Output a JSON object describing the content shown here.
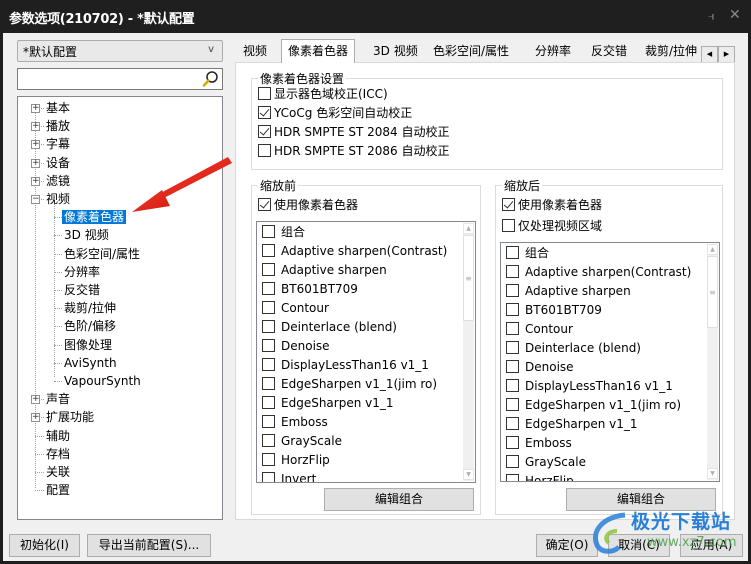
{
  "window": {
    "title": "参数选项(210702) - *默认配置",
    "pin_icon": "pin-icon",
    "close_icon": "close-icon"
  },
  "sidebar": {
    "profile_select": {
      "value": "*默认配置",
      "arrow": "v"
    },
    "search": {
      "value": "",
      "placeholder": "",
      "icon": "magnifier-icon"
    },
    "tree": [
      {
        "label": "基本",
        "level": 0,
        "expander": "+"
      },
      {
        "label": "播放",
        "level": 0,
        "expander": "+"
      },
      {
        "label": "字幕",
        "level": 0,
        "expander": "+"
      },
      {
        "label": "设备",
        "level": 0,
        "expander": "+"
      },
      {
        "label": "滤镜",
        "level": 0,
        "expander": "+"
      },
      {
        "label": "视频",
        "level": 0,
        "expander": "−"
      },
      {
        "label": "像素着色器",
        "level": 1,
        "selected": true
      },
      {
        "label": "3D 视频",
        "level": 1
      },
      {
        "label": "色彩空间/属性",
        "level": 1
      },
      {
        "label": "分辨率",
        "level": 1
      },
      {
        "label": "反交错",
        "level": 1
      },
      {
        "label": "裁剪/拉伸",
        "level": 1
      },
      {
        "label": "色阶/偏移",
        "level": 1
      },
      {
        "label": "图像处理",
        "level": 1
      },
      {
        "label": "AviSynth",
        "level": 1
      },
      {
        "label": "VapourSynth",
        "level": 1
      },
      {
        "label": "声音",
        "level": 0,
        "expander": "+"
      },
      {
        "label": "扩展功能",
        "level": 0,
        "expander": "+"
      },
      {
        "label": "辅助",
        "level": 0
      },
      {
        "label": "存档",
        "level": 0
      },
      {
        "label": "关联",
        "level": 0
      },
      {
        "label": "配置",
        "level": 0
      }
    ]
  },
  "tabs": {
    "items": [
      "视频",
      "像素着色器",
      "3D 视频",
      "色彩空间/属性",
      "分辨率",
      "反交错",
      "裁剪/拉伸"
    ],
    "active": "像素着色器",
    "scroll_left": "◀",
    "scroll_right": "▶"
  },
  "shader_settings": {
    "legend": "像素着色器设置",
    "options": [
      {
        "label": "显示器色域校正(ICC)",
        "checked": false
      },
      {
        "label": "YCoCg 色彩空间自动校正",
        "checked": true
      },
      {
        "label": "HDR SMPTE ST 2084 自动校正",
        "checked": true
      },
      {
        "label": "HDR SMPTE ST 2086 自动校正",
        "checked": false
      }
    ]
  },
  "pre_resize": {
    "legend": "缩放前",
    "use_shader": {
      "label": "使用像素着色器",
      "checked": true
    },
    "list": [
      "组合",
      "Adaptive sharpen(Contrast)",
      "Adaptive sharpen",
      "BT601BT709",
      "Contour",
      "Deinterlace (blend)",
      "Denoise",
      "DisplayLessThan16 v1_1",
      "EdgeSharpen v1_1(jim ro)",
      "EdgeSharpen v1_1",
      "Emboss",
      "GrayScale",
      "HorzFlip",
      "Invert"
    ],
    "edit_button": "编辑组合"
  },
  "post_resize": {
    "legend": "缩放后",
    "use_shader": {
      "label": "使用像素着色器",
      "checked": true
    },
    "video_only": {
      "label": "仅处理视频区域",
      "checked": false
    },
    "list": [
      "组合",
      "Adaptive sharpen(Contrast)",
      "Adaptive sharpen",
      "BT601BT709",
      "Contour",
      "Deinterlace (blend)",
      "Denoise",
      "DisplayLessThan16 v1_1",
      "EdgeSharpen v1_1(jim ro)",
      "EdgeSharpen v1_1",
      "Emboss",
      "GrayScale",
      "HorzFlip"
    ],
    "edit_button": "编辑组合"
  },
  "footer": {
    "init_button": "初始化(I)",
    "export_button": "导出当前配置(S)...",
    "ok_button": "确定(O)",
    "cancel_button": "取消(C)",
    "apply_button": "应用(A)"
  },
  "watermark": {
    "text": "极光下载站",
    "url": "www.xz7.com"
  },
  "annotation": {
    "type": "red-arrow",
    "color": "#e8231f",
    "points_to": "像素着色器"
  }
}
